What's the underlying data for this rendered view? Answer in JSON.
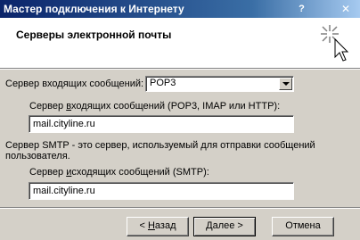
{
  "window": {
    "title": "Мастер подключения к Интернету",
    "help_glyph": "?",
    "close_glyph": "✕"
  },
  "header": {
    "heading": "Серверы электронной почты",
    "icon": "wizard-sparkle-cursor-icon"
  },
  "incoming": {
    "type_label": "Сервер входящих сообщений:",
    "type_value": "POP3",
    "server_label_prefix": "Сервер ",
    "server_label_accel": "в",
    "server_label_suffix": "ходящих сообщений (POP3, IMAP или HTTP):",
    "server_value": "mail.cityline.ru"
  },
  "smtp": {
    "note_line1": "Сервер SMTP - это сервер, используемый для отправки сообщений",
    "note_line2": "пользователя.",
    "server_label_prefix": "Сервер ",
    "server_label_accel": "и",
    "server_label_suffix": "сходящих сообщений (SMTP):",
    "server_value": "mail.cityline.ru"
  },
  "buttons": {
    "back_prefix": "< ",
    "back_accel": "Н",
    "back_suffix": "азад",
    "next": "Далее >",
    "cancel": "Отмена"
  }
}
